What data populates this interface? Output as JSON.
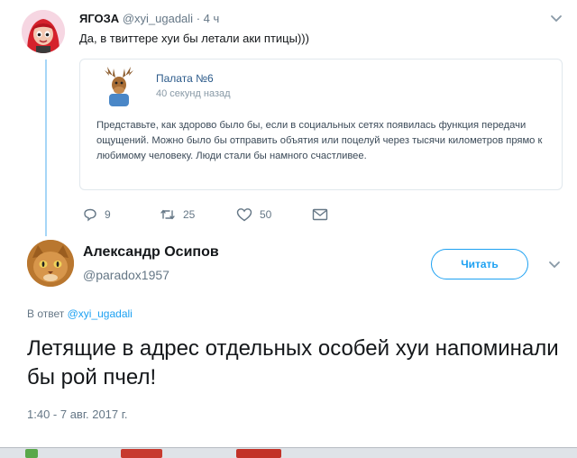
{
  "original_tweet": {
    "author_name": "ЯГОЗА",
    "author_handle": "@xyi_ugadali",
    "age": "· 4 ч",
    "text": "Да, в твиттере хуи бы летали аки птицы)))",
    "quoted": {
      "author_name": "Палата №6",
      "time": "40 секунд назад",
      "text": "Представьте, как здорово было бы, если в социальных сетях появилась функция передачи ощущений. Можно было бы отправить объятия или поцелуй через тысячи километров прямо к любимому человеку. Люди стали бы намного счастливее."
    },
    "actions": {
      "replies": "9",
      "retweets": "25",
      "likes": "50"
    }
  },
  "main_tweet": {
    "author_name": "Александр Осипов",
    "author_handle": "@paradox1957",
    "follow_label": "Читать",
    "reply_prefix": "В ответ",
    "reply_handle": "@xyi_ugadali",
    "text": "Летящие в адрес отдельных особей хуи напоминали бы рой пчел!",
    "timestamp": "1:40 - 7 авг. 2017 г."
  },
  "colors": {
    "accent": "#1da1f2",
    "thread_line": "#a6d6f7",
    "muted": "#657786"
  },
  "icons": {
    "reply": "reply-icon",
    "retweet": "retweet-icon",
    "like": "heart-icon",
    "dm": "envelope-icon",
    "caret": "chevron-down-icon"
  }
}
